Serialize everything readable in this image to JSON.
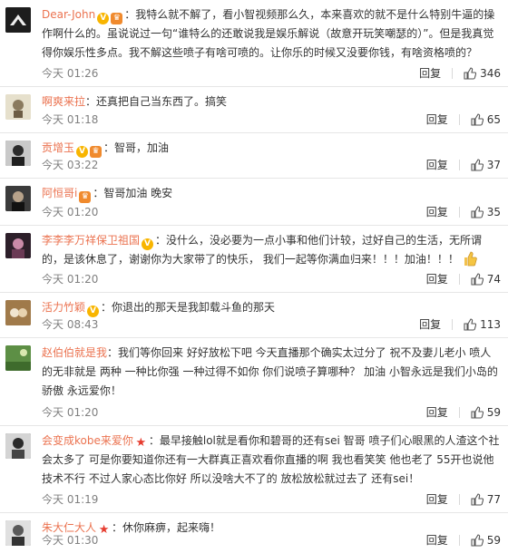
{
  "actions": {
    "reply_label": "回复"
  },
  "comments": [
    {
      "name": "Dear-John",
      "badges": [
        "v",
        "vip"
      ],
      "text": "：我特么就不解了，看小智视频那么久，本来喜欢的就不是什么特别牛逼的操作啊什么的。虽说说过一句“谁特么的还敢说我是娱乐解说（故意开玩笑嘲瑟的）”。但是我真觉得你娱乐性多点。我不解这些喷子有啥可喷的。让你乐的时候又没要你钱，有啥资格喷的？",
      "time": "今天 01:26",
      "likes": "346",
      "avatar_color": "#2a2a2a"
    },
    {
      "name": "啊爽来拉",
      "badges": [],
      "text": "：还真把自己当东西了。搞笑",
      "time": "今天 01:18",
      "likes": "65",
      "avatar_color": "#d9d4c4"
    },
    {
      "name": "贡增玉",
      "badges": [
        "v",
        "vip"
      ],
      "text": "：智哥，加油",
      "time": "今天 03:22",
      "likes": "37",
      "avatar_color": "#3a3a3a"
    },
    {
      "name": "阿恒哥i",
      "badges": [
        "vip"
      ],
      "text": "：智哥加油 晚安",
      "time": "今天 01:20",
      "likes": "35",
      "avatar_color": "#2e2e2e"
    },
    {
      "name": "李李李万祥保卫祖国",
      "badges": [
        "v"
      ],
      "text": "：没什么，没必要为一点小事和他们计较，过好自己的生活，无所谓的，是该休息了，谢谢你为大家带了的快乐， 我们一起等你满血归来！！！加油！！！",
      "time": "今天 01:20",
      "likes": "74",
      "avatar_color": "#3b2a35"
    },
    {
      "name": "活力竹颖",
      "badges": [
        "v"
      ],
      "text": "：你退出的那天是我卸载斗鱼的那天",
      "time": "今天 08:43",
      "likes": "113",
      "avatar_color": "#8a6a45"
    },
    {
      "name": "赵伯伯就是我",
      "badges": [],
      "text": "：我们等你回来 好好放松下吧 今天直播那个确实太过分了 祝不及妻儿老小 喷人的无非就是 两种 一种比你强 一种过得不如你 你们说喷子算哪种？ 加油 小智永远是我们小岛的骄傲 永远爱你！",
      "time": "今天 01:20",
      "likes": "59",
      "avatar_color": "#4a7a3a"
    },
    {
      "name": "会变成kobe来爱你",
      "badges": [
        "star"
      ],
      "text": "：最早接触lol就是看你和碧哥的还有sei 智哥 喷子们心眼黑的人渣这个社会太多了 可是你要知道你还有一大群真正喜欢看你直播的啊 我也看笑笑 他也老了 55开也说他技术不行 不过人家心态比你好 所以没啥大不了的 放松放松就过去了 还有sei！",
      "time": "今天 01:19",
      "likes": "77",
      "avatar_color": "#3a3a3a"
    },
    {
      "name": "朱大仁大人",
      "badges": [
        "star"
      ],
      "text": "：休你麻痹，起来嗨！",
      "time": "今天 01:30",
      "likes": "59",
      "avatar_color": "#555555"
    }
  ]
}
